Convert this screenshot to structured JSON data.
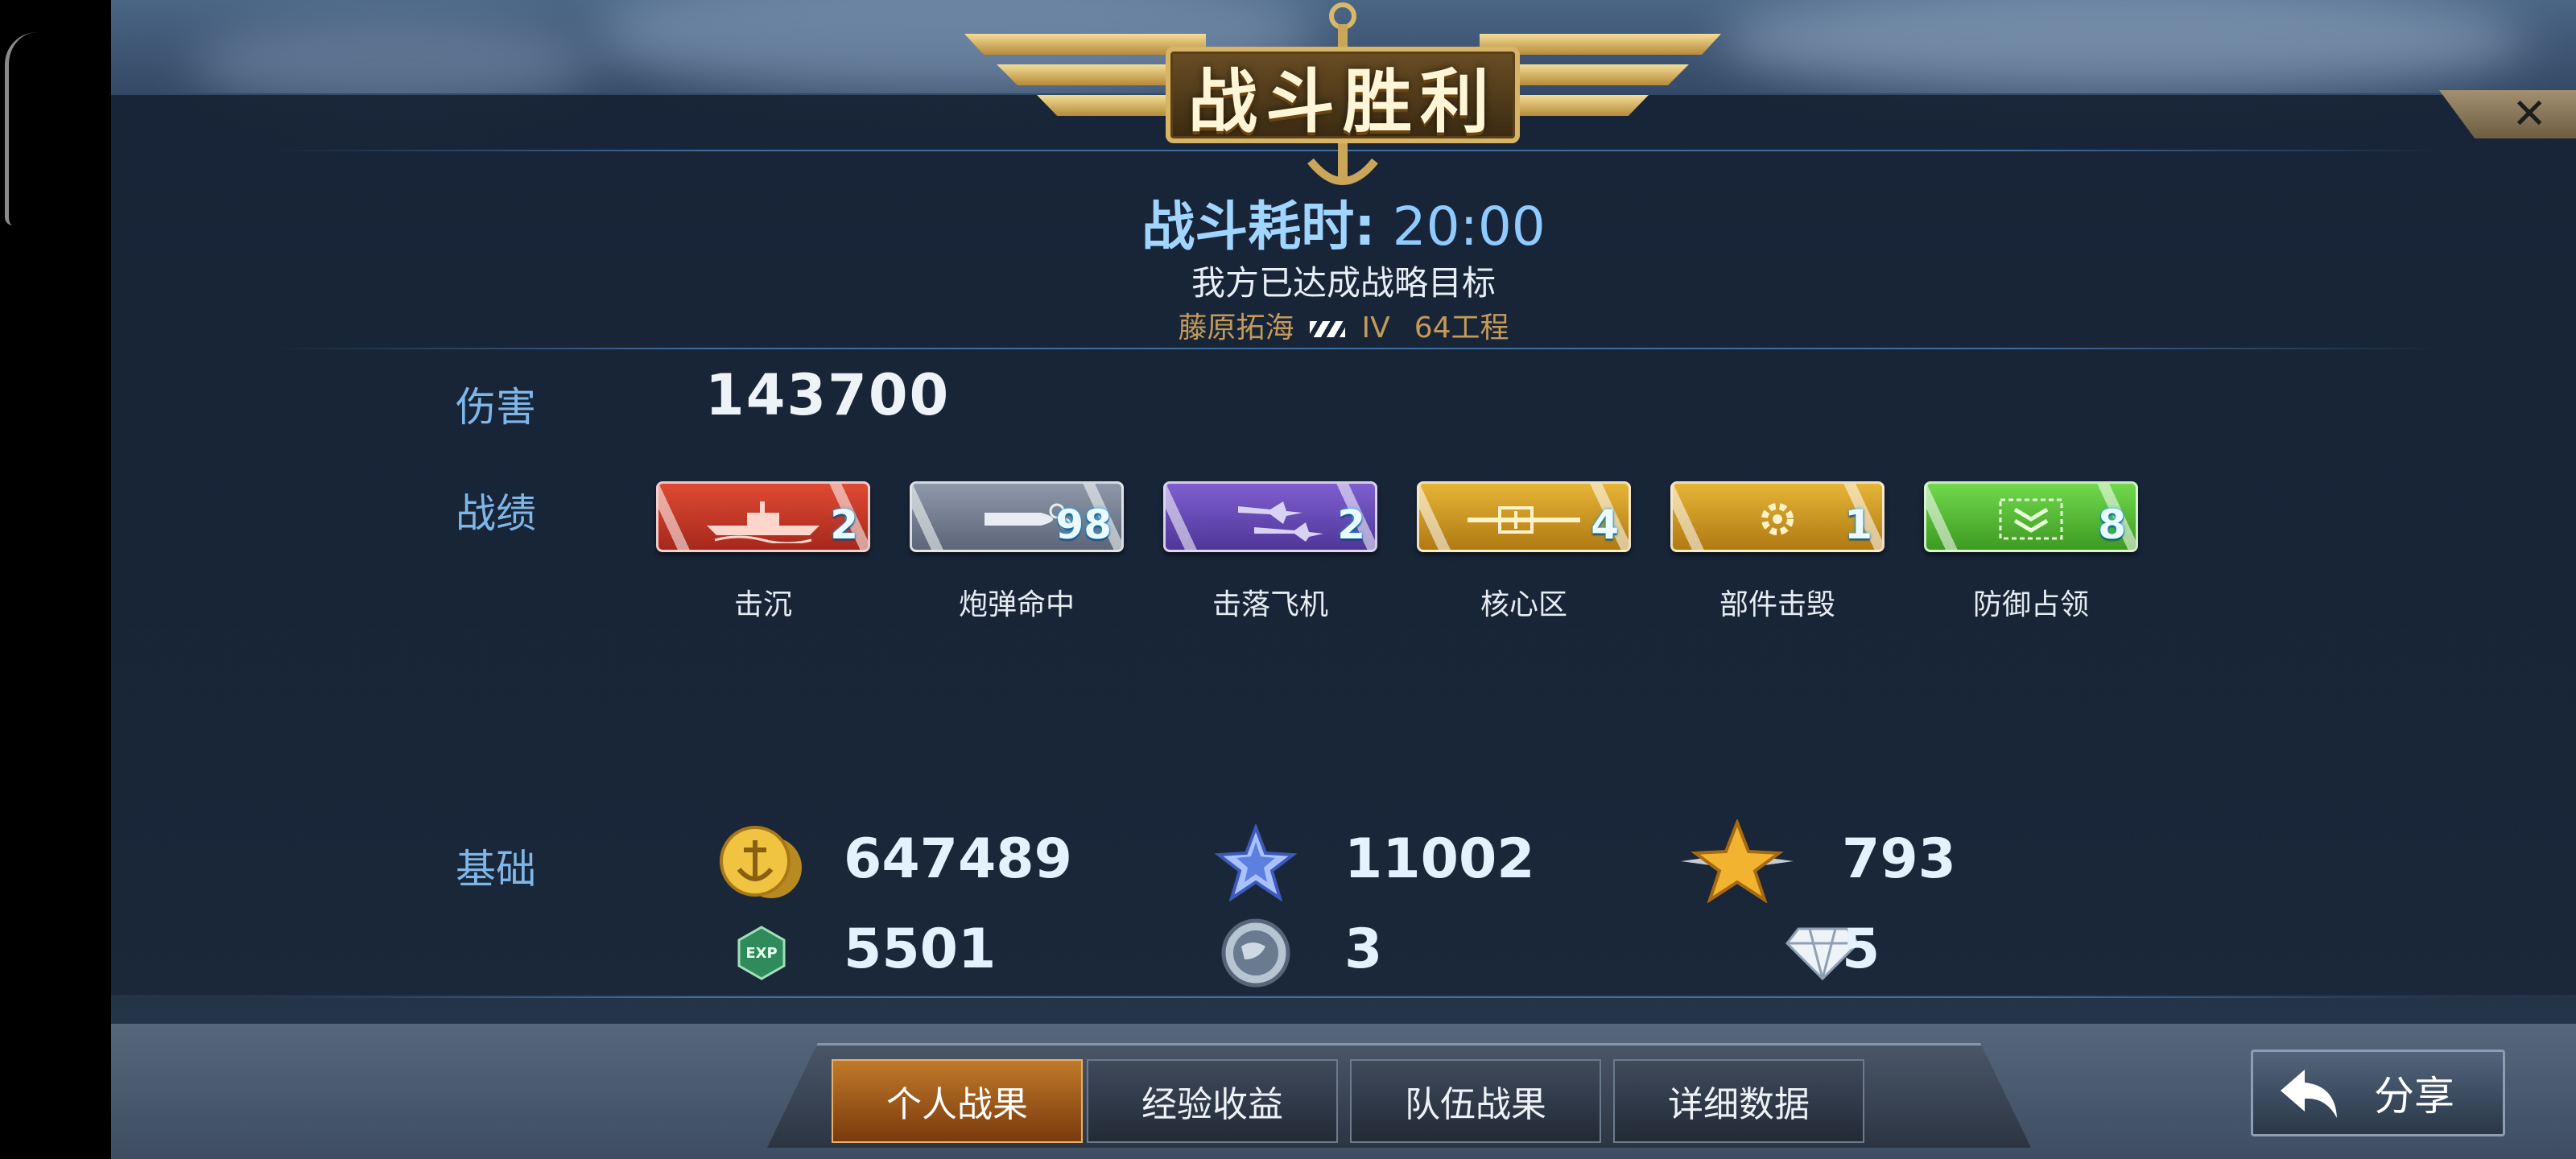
{
  "banner": {
    "title": "战斗胜利"
  },
  "close": {
    "label": "✕"
  },
  "battle": {
    "duration_label": "战斗耗时:",
    "duration_value": "20:00",
    "objective": "我方已达成战略目标",
    "player_name": "藤原拓海",
    "ship_tier": "IV",
    "ship_name": "64工程"
  },
  "damage": {
    "label": "伤害",
    "value": "143700"
  },
  "achievements": {
    "label": "战绩",
    "items": [
      {
        "name": "击沉",
        "count": "2",
        "color": "#c9382a",
        "icon": "ship-icon"
      },
      {
        "name": "炮弹命中",
        "count": "98",
        "color": "#7d8799",
        "icon": "shell-icon"
      },
      {
        "name": "击落飞机",
        "count": "2",
        "color": "#6a4ab0",
        "icon": "plane-icon"
      },
      {
        "name": "核心区",
        "count": "4",
        "color": "#d29a22",
        "icon": "core-icon"
      },
      {
        "name": "部件击毁",
        "count": "1",
        "color": "#d29a22",
        "icon": "gear-icon"
      },
      {
        "name": "防御占领",
        "count": "8",
        "color": "#5ac43a",
        "icon": "chevron-icon"
      }
    ]
  },
  "basics": {
    "label": "基础",
    "silver": "647489",
    "blue_star": "11002",
    "gold_star": "793",
    "exp": "5501",
    "globe": "3",
    "diamond": "5"
  },
  "tabs": [
    "个人战果",
    "经验收益",
    "队伍战果",
    "详细数据"
  ],
  "share": {
    "label": "分享"
  }
}
